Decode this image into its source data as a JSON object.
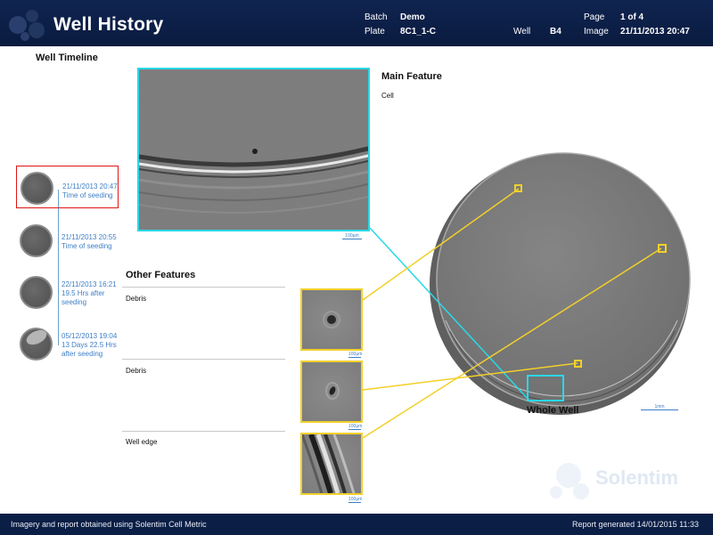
{
  "header": {
    "title": "Well History",
    "batch_label": "Batch",
    "batch_value": "Demo",
    "plate_label": "Plate",
    "plate_value": "8C1_1-C",
    "well_label": "Well",
    "well_value": "B4",
    "page_label": "Page",
    "page_value": "1 of 4",
    "image_label": "Image",
    "image_value": "21/11/2013 20:47"
  },
  "timeline": {
    "title": "Well Timeline",
    "items": [
      {
        "date": "21/11/2013 20:47",
        "note": "Time of seeding",
        "selected": true
      },
      {
        "date": "21/11/2013 20:55",
        "note": "Time of seeding"
      },
      {
        "date": "22/11/2013 16:21",
        "note": "19.5 Hrs after seeding"
      },
      {
        "date": "05/12/2013 19:04",
        "note": "13 Days 22.5 Hrs after seeding"
      }
    ]
  },
  "main_feature": {
    "title": "Main Feature",
    "description": "Cell",
    "scale": "100µm"
  },
  "other_features": {
    "title": "Other Features",
    "items": [
      {
        "label": "Debris",
        "scale": "100µm"
      },
      {
        "label": "Debris",
        "scale": "100µm"
      },
      {
        "label": "Well edge",
        "scale": "100µm"
      }
    ]
  },
  "whole_well": {
    "title": "Whole Well",
    "scale": "1mm"
  },
  "watermark": {
    "brand": "Solentim"
  },
  "footer": {
    "left": "Imagery and report obtained using Solentim Cell Metric",
    "right": "Report generated 14/01/2015 11:33"
  },
  "colors": {
    "header_bg": "#0f2450",
    "main_box": "#29d8e8",
    "feature_box": "#f2d02b",
    "timeline_text": "#3e7fc6",
    "selected_border": "#e01515"
  }
}
